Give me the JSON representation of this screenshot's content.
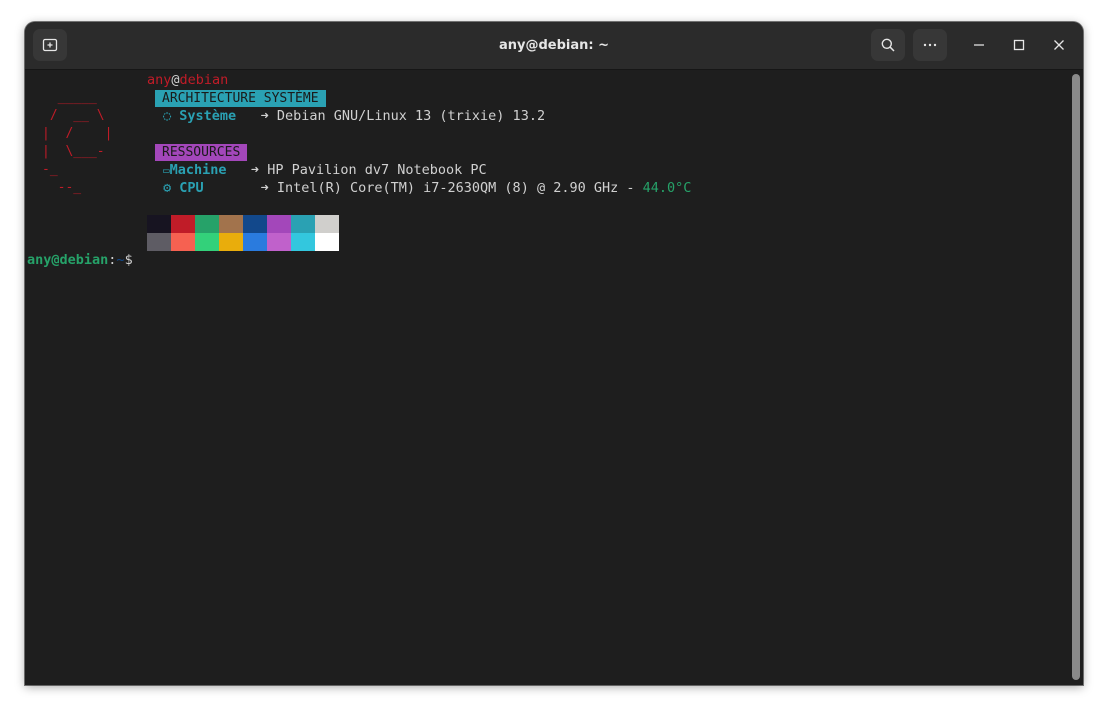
{
  "window": {
    "title": "any@debian: ~"
  },
  "prompt_header": {
    "user": "any",
    "at": "@",
    "host": "debian"
  },
  "logo_ascii": "  _____\n /  __ \\\n|  /    |\n|  \\___-\n-_\n  --_",
  "sections": {
    "arch": {
      "label": "ARCHITECTURE SYSTÈME",
      "bg_color": "#2aa1b3",
      "rows": [
        {
          "icon": "debian-swirl-icon",
          "glyph": "◌",
          "key": "Système",
          "arrow": "➜",
          "value": "Debian GNU/Linux 13 (trixie) 13.2"
        }
      ]
    },
    "resources": {
      "label": "RESSOURCES",
      "bg_color": "#a347ba",
      "rows": [
        {
          "icon": "laptop-icon",
          "glyph": "💻",
          "key": "Machine",
          "arrow": "➜",
          "value": "HP Pavilion dv7 Notebook PC"
        },
        {
          "icon": "chip-icon",
          "glyph": "⚙",
          "key": "CPU",
          "arrow": "➜",
          "value": "Intel(R) Core(TM) i7-2630QM (8) @ 2.90 GHz - ",
          "temp": "44.0°C"
        }
      ]
    }
  },
  "palette": {
    "normal": [
      "#171421",
      "#c01c28",
      "#26a269",
      "#a2734c",
      "#12488b",
      "#a347ba",
      "#2aa1b3",
      "#d0cfcc"
    ],
    "bright": [
      "#5e5c64",
      "#f66151",
      "#33d17a",
      "#e9ad0c",
      "#2a7bde",
      "#c061cb",
      "#33c7de",
      "#ffffff"
    ]
  },
  "shell_prompt": {
    "user_host": "any@debian",
    "colon": ":",
    "path": "~",
    "symbol": "$"
  }
}
